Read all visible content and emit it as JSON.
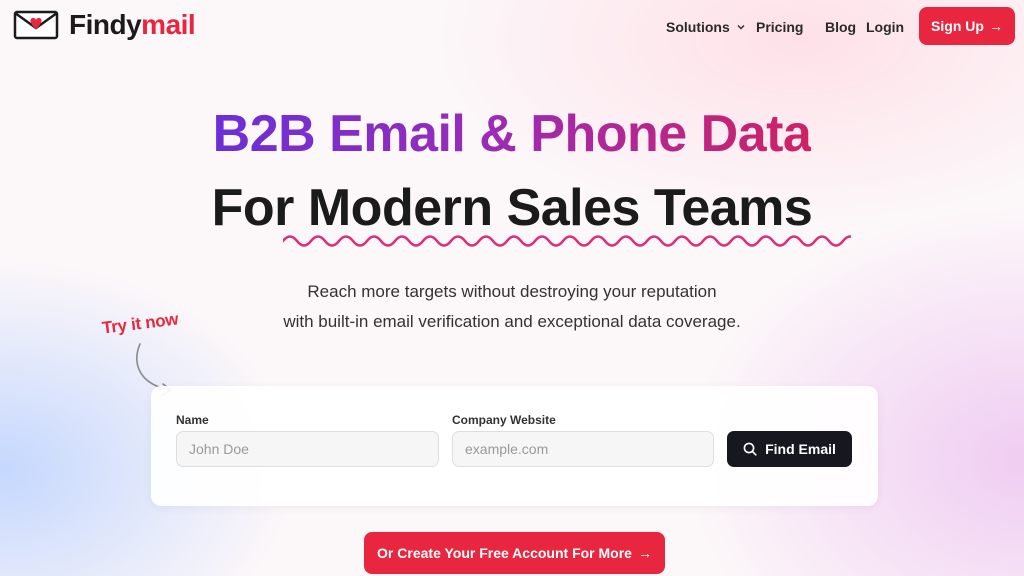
{
  "brand": {
    "name_part1": "Findy",
    "name_part2": "mail",
    "logo_icon": "envelope-heart-icon",
    "accent_color": "#e8263f"
  },
  "nav": {
    "solutions": "Solutions",
    "pricing": "Pricing",
    "blog": "Blog",
    "login": "Login",
    "signup": "Sign Up",
    "signup_arrow": "→"
  },
  "hero": {
    "line1": "B2B Email & Phone Data",
    "line2": "For Modern Sales Teams",
    "sub1": "Reach more targets without destroying your reputation",
    "sub2": "with built-in email verification and exceptional data coverage."
  },
  "try_it": "Try it now",
  "form": {
    "name_label": "Name",
    "name_placeholder": "John Doe",
    "site_label": "Company Website",
    "site_placeholder": "example.com",
    "find_button": "Find Email"
  },
  "cta": {
    "label": "Or Create Your Free Account For More",
    "arrow": "→"
  }
}
